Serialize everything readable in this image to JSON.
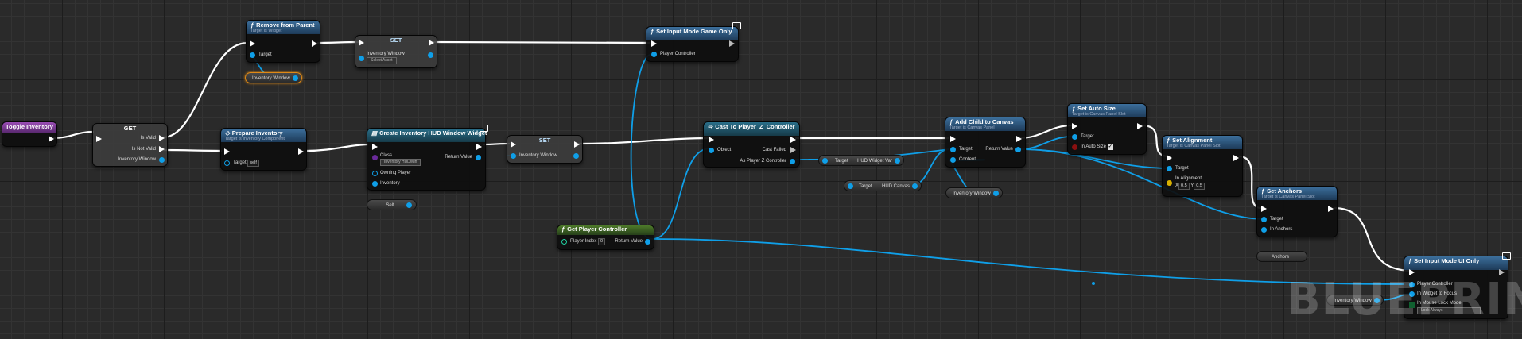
{
  "watermark": "BLUEPRINT",
  "nodes": {
    "toggle": {
      "title": "Toggle Inventory"
    },
    "get": {
      "title": "GET",
      "is_valid": "Is Valid",
      "is_not_valid": "Is Not Valid",
      "inventory_window": "Inventory Window"
    },
    "remove": {
      "title": "Remove from Parent",
      "subtitle": "Target is Widget",
      "target": "Target"
    },
    "inv_var1": {
      "label": "Inventory Window"
    },
    "set1": {
      "title": "SET",
      "pin": "Inventory Window",
      "dropdown": "Select Asset"
    },
    "input_game": {
      "title": "Set Input Mode Game Only",
      "player_controller": "Player Controller"
    },
    "prepare": {
      "title": "Prepare Inventory",
      "subtitle": "Target is Inventory Component",
      "target": "Target",
      "target_value": "self"
    },
    "create": {
      "title": "Create Inventory HUD Window Widget",
      "class": "Class",
      "class_value": "Inventory HUDWin",
      "return_value": "Return Value",
      "owning_player": "Owning Player",
      "inventory": "Inventory"
    },
    "self_pill": {
      "label": "Self"
    },
    "set2": {
      "title": "SET",
      "pin": "Inventory Window"
    },
    "cast": {
      "title": "Cast To Player_Z_Controller",
      "object": "Object",
      "cast_failed": "Cast Failed",
      "as_player": "As Player Z Controller"
    },
    "hud_var": {
      "target": "Target",
      "label": "HUD Widget Var"
    },
    "hud_canvas": {
      "target": "Target",
      "label": "HUD Canvas"
    },
    "add_child": {
      "title": "Add Child to Canvas",
      "subtitle": "Target is Canvas Panel",
      "target": "Target",
      "return_value": "Return Value",
      "content": "Content"
    },
    "inv_var2": {
      "label": "Inventory Window"
    },
    "auto_size": {
      "title": "Set Auto Size",
      "subtitle": "Target is Canvas Panel Slot",
      "target": "Target",
      "in_auto_size": "In Auto Size"
    },
    "alignment": {
      "title": "Set Alignment",
      "subtitle": "Target is Canvas Panel Slot",
      "target": "Target",
      "in_alignment": "In Alignment",
      "x_label": "X",
      "x_value": "0.5",
      "y_label": "Y",
      "y_value": "0.5"
    },
    "anchors": {
      "title": "Set Anchors",
      "subtitle": "Target is Canvas Panel Slot",
      "target": "Target",
      "in_anchors": "In Anchors"
    },
    "anchors_pill": {
      "label": "Anchors"
    },
    "get_pc": {
      "title": "Get Player Controller",
      "player_index": "Player Index",
      "player_index_value": "0",
      "return_value": "Return Value"
    },
    "input_ui": {
      "title": "Set Input Mode UI Only",
      "player_controller": "Player Controller",
      "in_widget": "In Widget to Focus",
      "in_mouse": "In Mouse Lock Mode",
      "mouse_value": "Lock Always"
    },
    "inv_var3": {
      "label": "Inventory Window"
    }
  }
}
